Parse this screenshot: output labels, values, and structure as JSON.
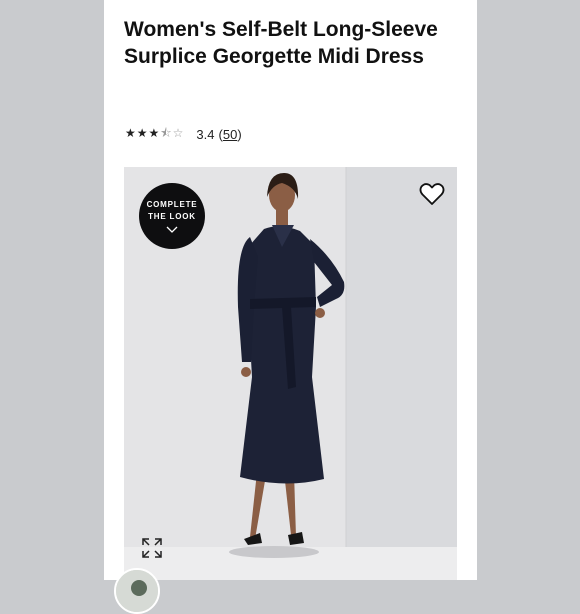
{
  "product": {
    "title": "Women's Self-Belt Long-Sleeve Surplice Georgette Midi Dress",
    "rating": {
      "stars": 3.4,
      "value_text": "3.4",
      "review_count": "50"
    }
  },
  "image": {
    "complete_look_line1": "COMPLETE",
    "complete_look_line2": "THE LOOK"
  },
  "icons": [
    "star-icon",
    "heart-icon",
    "chevron-down-icon",
    "expand-icon"
  ],
  "colors": {
    "dress": "#1d2236",
    "background": "#c9cbce",
    "badge": "#0e0e10"
  }
}
